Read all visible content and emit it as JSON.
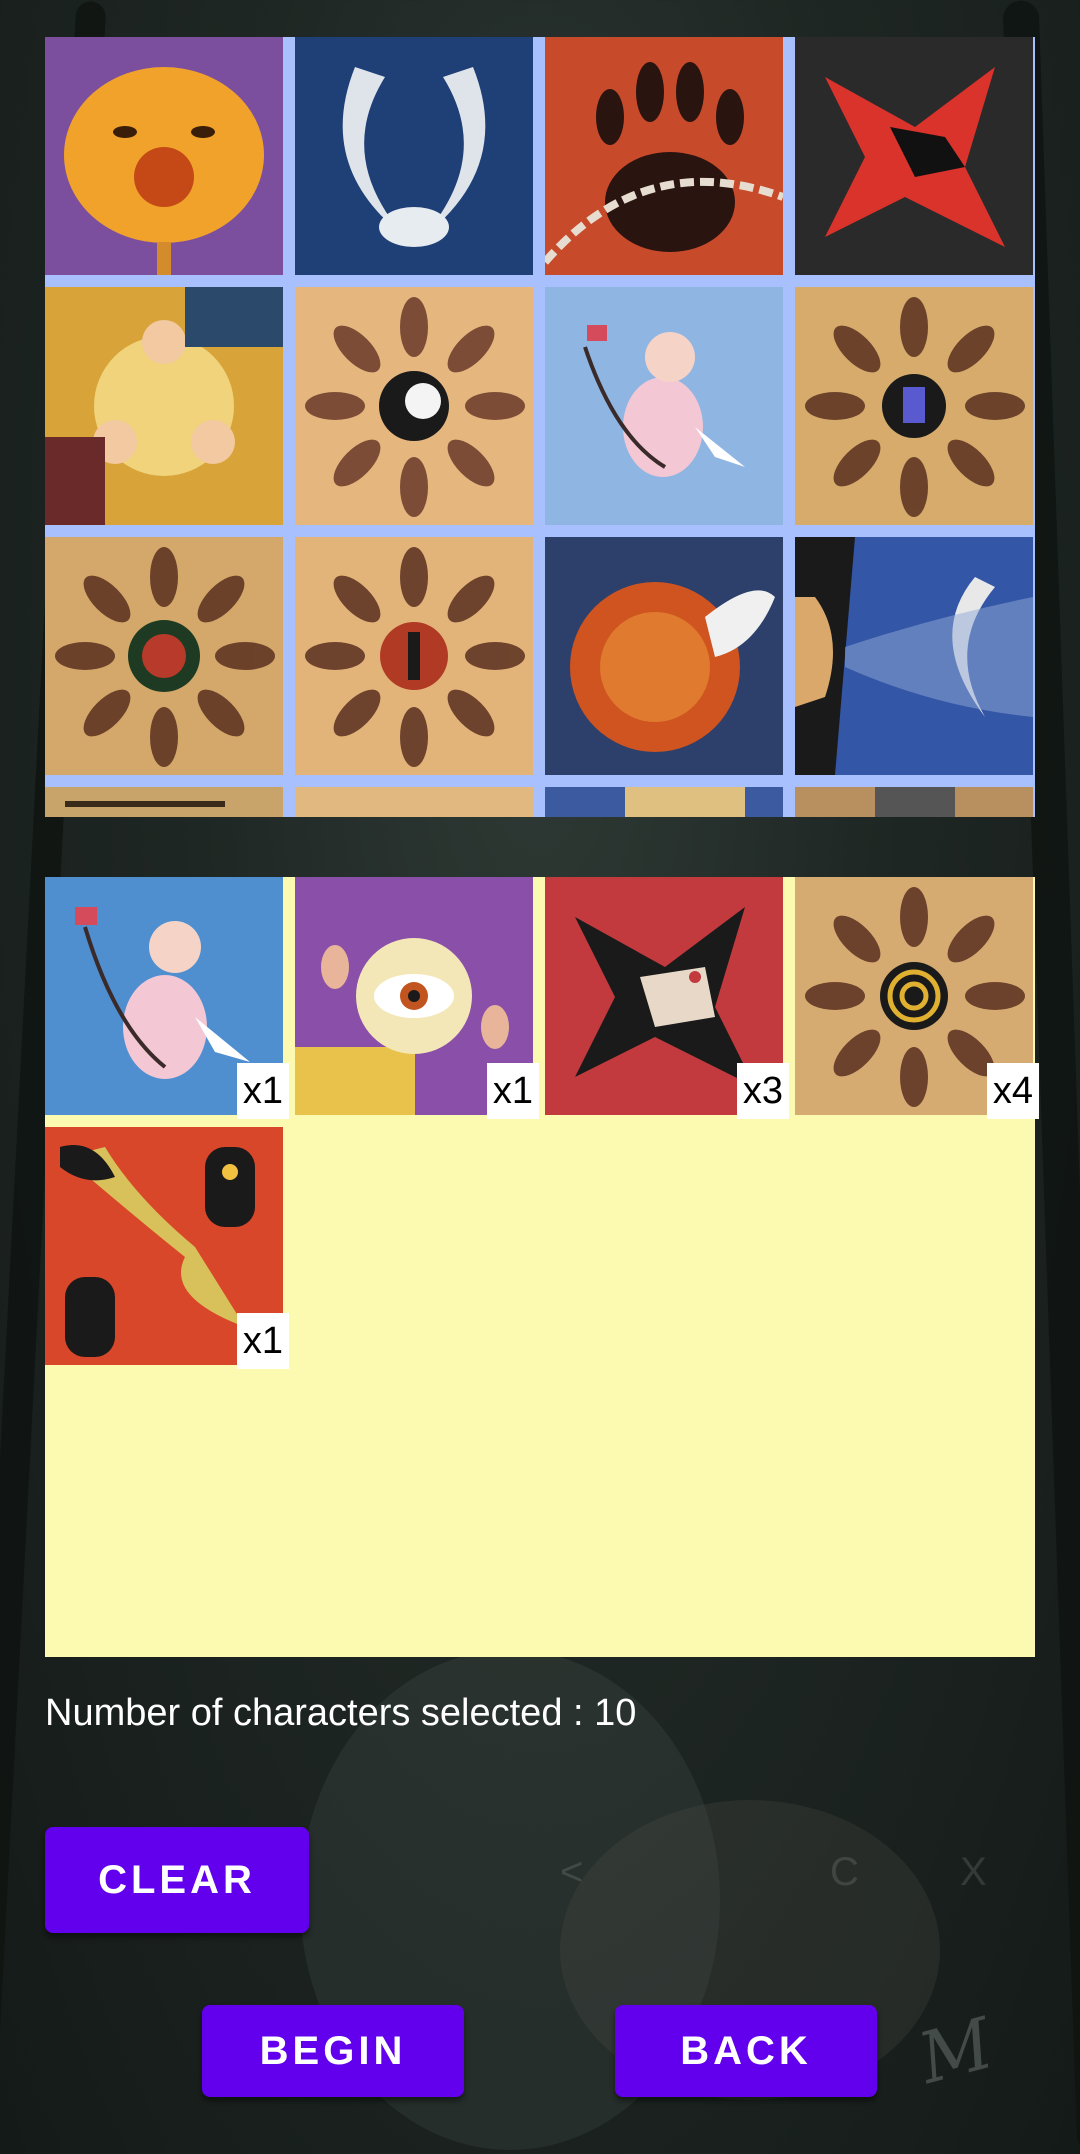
{
  "catalog": {
    "cards": [
      {
        "name": "three-faced-sun-card"
      },
      {
        "name": "winged-angel-card"
      },
      {
        "name": "chained-paw-card"
      },
      {
        "name": "red-wolf-card"
      },
      {
        "name": "three-men-card"
      },
      {
        "name": "villagers-eagle-card"
      },
      {
        "name": "cupid-card"
      },
      {
        "name": "villagers-peace-hand-card"
      },
      {
        "name": "villagers-tree-card"
      },
      {
        "name": "villagers-figure-card"
      },
      {
        "name": "fox-card"
      },
      {
        "name": "moon-wind-card"
      }
    ]
  },
  "selected": {
    "cards": [
      {
        "name": "cupid-card",
        "count": "x1"
      },
      {
        "name": "seer-eye-card",
        "count": "x1"
      },
      {
        "name": "black-wolf-card",
        "count": "x3"
      },
      {
        "name": "villagers-spiral-card",
        "count": "x4"
      },
      {
        "name": "witch-potions-card",
        "count": "x1"
      }
    ]
  },
  "status": {
    "count_label": "Number of characters selected : 10"
  },
  "buttons": {
    "clear": "CLEAR",
    "begin": "BEGIN",
    "back": "BACK"
  },
  "colors": {
    "button": "#6200ee",
    "catalog_bg": "#a9c0ff",
    "selected_bg": "#fcf9b1"
  }
}
